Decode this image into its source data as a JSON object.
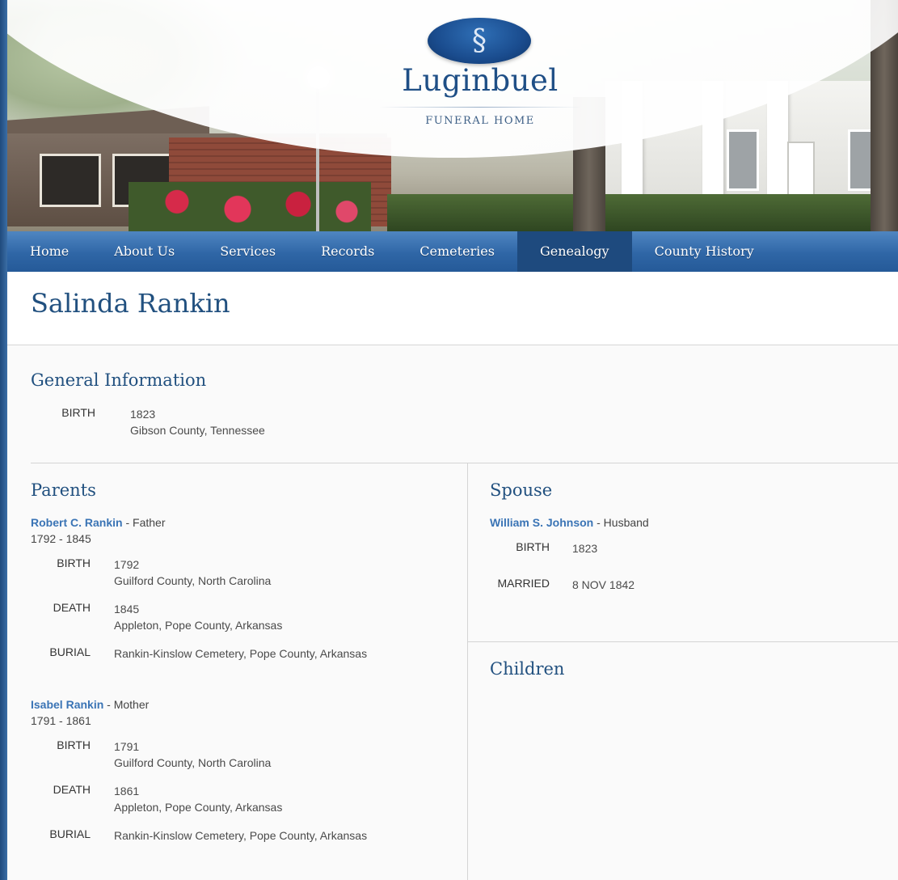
{
  "logo": {
    "monogram": "§",
    "name": "Luginbuel",
    "subtitle": "FUNERAL HOME"
  },
  "nav": {
    "items": [
      {
        "label": "Home",
        "active": false
      },
      {
        "label": "About Us",
        "active": false
      },
      {
        "label": "Services",
        "active": false
      },
      {
        "label": "Records",
        "active": false
      },
      {
        "label": "Cemeteries",
        "active": false
      },
      {
        "label": "Genealogy",
        "active": true
      },
      {
        "label": "County History",
        "active": false
      }
    ]
  },
  "page": {
    "title": "Salinda Rankin"
  },
  "general": {
    "heading": "General Information",
    "birth_label": "BIRTH",
    "birth_date": "1823",
    "birth_place": "Gibson County, Tennessee"
  },
  "parents": {
    "heading": "Parents",
    "father": {
      "name": "Robert C. Rankin",
      "relation": " - Father",
      "years": "1792 - 1845",
      "birth_label": "BIRTH",
      "birth_date": "1792",
      "birth_place": "Guilford County, North Carolina",
      "death_label": "DEATH",
      "death_date": "1845",
      "death_place": "Appleton, Pope County, Arkansas",
      "burial_label": "BURIAL",
      "burial_place": "Rankin-Kinslow Cemetery, Pope County, Arkansas"
    },
    "mother": {
      "name": "Isabel Rankin",
      "relation": " - Mother",
      "years": "1791 - 1861",
      "birth_label": "BIRTH",
      "birth_date": "1791",
      "birth_place": "Guilford County, North Carolina",
      "death_label": "DEATH",
      "death_date": "1861",
      "death_place": "Appleton, Pope County, Arkansas",
      "burial_label": "BURIAL",
      "burial_place": "Rankin-Kinslow Cemetery, Pope County, Arkansas"
    }
  },
  "spouse": {
    "heading": "Spouse",
    "name": "William S. Johnson",
    "relation": " - Husband",
    "birth_label": "BIRTH",
    "birth_date": "1823",
    "married_label": "MARRIED",
    "married_date": "8 NOV 1842"
  },
  "children": {
    "heading": "Children"
  },
  "colors": {
    "nav_bg": "#2f66a6",
    "nav_active": "#1e4a7e",
    "heading": "#21507f",
    "link": "#3a74b5"
  }
}
